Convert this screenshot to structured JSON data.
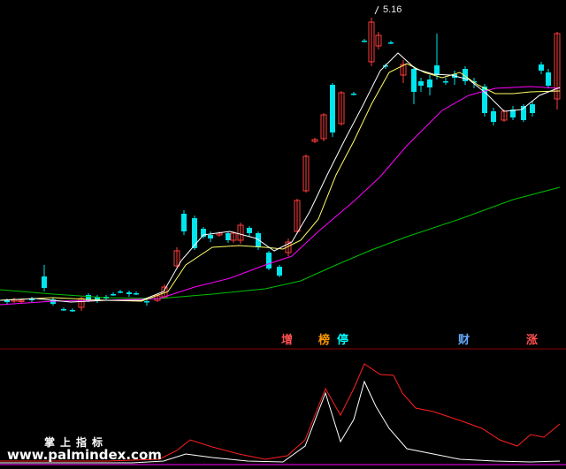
{
  "colors": {
    "background": "#000000",
    "up_candle": "#ff3c3c",
    "down_candle": "#00e5ee",
    "ma_white": "#ffffff",
    "ma_yellow": "#ffff66",
    "ma_magenta": "#ff00ff",
    "ma_green": "#00c000",
    "indicator_red": "#ff2020",
    "indicator_white": "#ffffff",
    "indicator_magenta": "#ff00ff",
    "divider": "#8b0000",
    "tag_red": "#ff5050",
    "tag_orange": "#ff9900",
    "tag_cyan": "#00ffff",
    "tag_blue": "#66aaff"
  },
  "price_panel": {
    "high_label": "5.16"
  },
  "signal_tags": [
    {
      "label": "增",
      "color": "#ff5050"
    },
    {
      "label": "榜",
      "color": "#ff9900"
    },
    {
      "label": "停",
      "color": "#00ffff"
    },
    {
      "label": "财",
      "color": "#66aaff"
    },
    {
      "label": "涨",
      "color": "#ff5050"
    }
  ],
  "watermark": {
    "title": "掌上指标",
    "url": "www.palmindex.com"
  }
}
